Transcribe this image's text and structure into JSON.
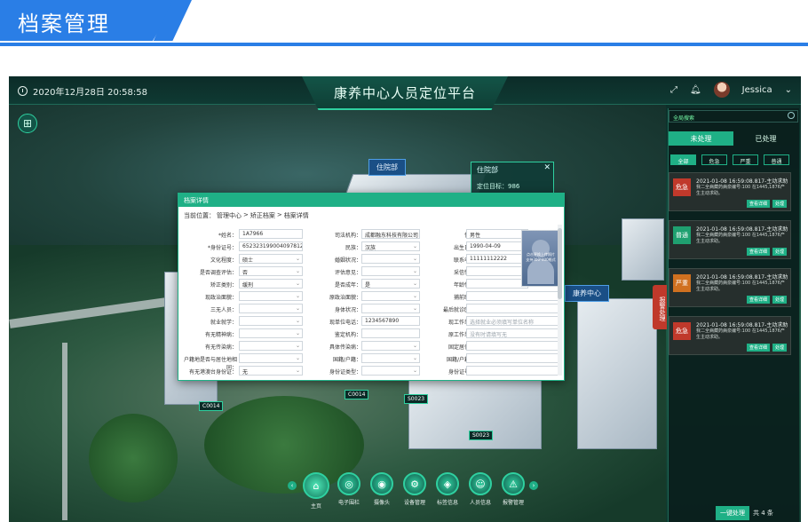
{
  "banner": {
    "title": "档案管理"
  },
  "header": {
    "datetime": "2020年12月28日 20:58:58",
    "title": "康养中心人员定位平台",
    "user": "Jessica"
  },
  "map": {
    "tags": [
      "住院部",
      "康养中心"
    ],
    "popup": {
      "title": "住院部",
      "target_label": "定位目标：986"
    },
    "markers": [
      "C0014",
      "S0023",
      "S0023",
      "C0014"
    ]
  },
  "dialog": {
    "title": "档案详情",
    "breadcrumb": [
      "当前位置：",
      "管理中心",
      ">",
      "矫正档案",
      ">",
      "档案详情"
    ],
    "photo_text": "点击更换上传照片\n支持300*400格式",
    "rows": [
      [
        {
          "label": "*姓名：",
          "value": "1A7966",
          "type": "text"
        },
        {
          "label": "司法机构：",
          "value": "成都融东科技有限公司",
          "type": "select"
        },
        {
          "label": "性别：",
          "value": "男性",
          "type": "select"
        }
      ],
      [
        {
          "label": "*身份证号：",
          "value": "652323199004097812",
          "type": "text"
        },
        {
          "label": "民族：",
          "value": "汉族",
          "type": "select"
        },
        {
          "label": "出生日期：",
          "value": "1990-04-09",
          "type": "select"
        }
      ],
      [
        {
          "label": "文化程度：",
          "value": "硕士",
          "type": "select"
        },
        {
          "label": "婚姻状况：",
          "value": "",
          "type": "select"
        },
        {
          "label": "联系电话：",
          "value": "11111112222",
          "type": "text"
        }
      ],
      [
        {
          "label": "是否调查评估：",
          "value": "否",
          "type": "select"
        },
        {
          "label": "评估意见：",
          "value": "",
          "type": "select"
        },
        {
          "label": "采信情况：",
          "value": "",
          "type": "select"
        }
      ],
      [
        {
          "label": "矫正类别：",
          "value": "缓刑",
          "type": "select"
        },
        {
          "label": "是否成年：",
          "value": "是",
          "type": "select"
        },
        {
          "label": "年龄情况：",
          "value": "",
          "type": "select"
        }
      ],
      [
        {
          "label": "现政治面貌：",
          "value": "",
          "type": "select"
        },
        {
          "label": "原政治面貌：",
          "value": "",
          "type": "select"
        },
        {
          "label": "捕前职业：",
          "value": "",
          "type": "select"
        }
      ],
      [
        {
          "label": "三无人员：",
          "value": "",
          "type": "select"
        },
        {
          "label": "身体状况：",
          "value": "",
          "type": "select"
        },
        {
          "label": "最后就诊医院：",
          "value": "",
          "type": "text"
        }
      ],
      [
        {
          "label": "就业就学：",
          "value": "",
          "type": "select"
        },
        {
          "label": "现单位电话：",
          "value": "1234567890",
          "type": "text"
        },
        {
          "label": "现工作单位：",
          "value": "",
          "placeholder": "选择就业必须填写单位名称",
          "type": "text"
        }
      ],
      [
        {
          "label": "有无精神病：",
          "value": "",
          "type": "select"
        },
        {
          "label": "鉴定机构：",
          "value": "",
          "type": "text"
        },
        {
          "label": "原工作单位：",
          "value": "",
          "placeholder": "没有时请填写无",
          "type": "text"
        }
      ],
      [
        {
          "label": "有无传染病：",
          "value": "",
          "type": "select"
        },
        {
          "label": "具体传染病：",
          "value": "",
          "type": "select"
        },
        {
          "label": "固定居住地：",
          "value": "",
          "type": "select"
        }
      ],
      [
        {
          "label": "户籍地是否与居住地相同：",
          "value": "",
          "type": "select"
        },
        {
          "label": "国籍/户籍：",
          "value": "",
          "type": "select"
        },
        {
          "label": "国籍/户籍地：",
          "value": "",
          "type": "select"
        }
      ],
      [
        {
          "label": "有无港澳台身份证：",
          "value": "无",
          "type": "select"
        },
        {
          "label": "身份证类型：",
          "value": "",
          "type": "select"
        },
        {
          "label": "身份证号码：",
          "value": "",
          "type": "text"
        }
      ]
    ]
  },
  "panel": {
    "search_placeholder": "全局搜索",
    "tabs": [
      "未处理",
      "已处理"
    ],
    "filters": [
      "全部",
      "危急",
      "严重",
      "普通"
    ],
    "side_tab": "报警处理",
    "cards": [
      {
        "level": "危急",
        "color": "#c0392b",
        "time": "2021-01-08 16:59:08.817-主动求助",
        "desc": "我二全病藏药病泉编号:100 在1445,1876产生主动求助。",
        "btn1": "查看详细",
        "btn2": "处理"
      },
      {
        "level": "普通",
        "color": "#1fa070",
        "time": "2021-01-08 16:59:08.817-主动求助",
        "desc": "我二全病藏药病泉编号:100 在1445,1876产生主动求助。",
        "btn1": "查看详细",
        "btn2": "处理"
      },
      {
        "level": "严重",
        "color": "#d07020",
        "time": "2021-01-08 16:59:08.817-主动求助",
        "desc": "我二全病藏药病泉编号:100 在1445,1876产生主动求助。",
        "btn1": "查看详细",
        "btn2": "处理"
      },
      {
        "level": "危急",
        "color": "#c0392b",
        "time": "2021-01-08 16:59:08.817-主动求助",
        "desc": "我二全病藏药病泉编号:100 在1445,1876产生主动求助。",
        "btn1": "查看详细",
        "btn2": "处理"
      }
    ],
    "onekey": "一键处理",
    "total": "共 4 条"
  },
  "nav": {
    "items": [
      {
        "label": "主页",
        "icon": "home-icon",
        "glyph": "⌂"
      },
      {
        "label": "电子围栏",
        "icon": "fence-icon",
        "glyph": "◎"
      },
      {
        "label": "摄像头",
        "icon": "camera-icon",
        "glyph": "◉"
      },
      {
        "label": "设备管理",
        "icon": "gear-icon",
        "glyph": "⚙"
      },
      {
        "label": "标签信息",
        "icon": "tag-icon",
        "glyph": "◈"
      },
      {
        "label": "人员信息",
        "icon": "person-icon",
        "glyph": "☺"
      },
      {
        "label": "报警管理",
        "icon": "alarm-icon",
        "glyph": "⚠"
      }
    ]
  }
}
